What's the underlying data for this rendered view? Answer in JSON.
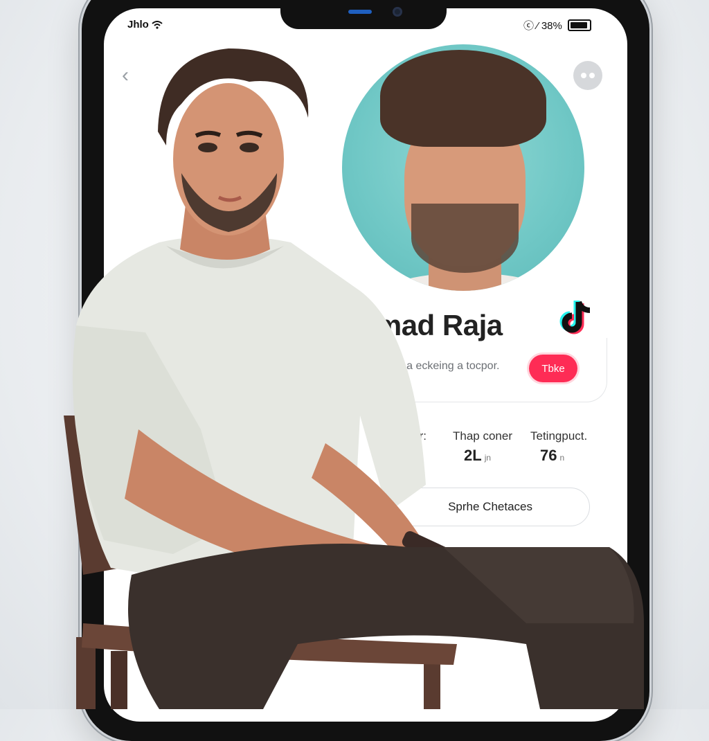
{
  "status_bar": {
    "carrier": "Jhlo",
    "right_text": "ⓒ ⁄ 38%"
  },
  "profile": {
    "name": "amad Raja",
    "bio": "duce a eckeing a tocpor.",
    "follow_label": "Tbke"
  },
  "stats": [
    {
      "label": "thar:",
      "value": ""
    },
    {
      "label": "Thap coner",
      "value": "2L",
      "unit": "jn"
    },
    {
      "label": "Tetingpuct.",
      "value": "76",
      "unit": "n"
    }
  ],
  "action": {
    "label": "Sprhe Chetaces"
  },
  "icons": {
    "back": "chevron-left-icon",
    "more": "more-icon",
    "wifi": "wifi-icon",
    "battery": "battery-icon",
    "brand": "tiktok-icon"
  },
  "colors": {
    "accent": "#fe2c55",
    "avatar_bg": "#6fc7c5",
    "tiktok_cyan": "#25f4ee",
    "tiktok_red": "#fe2c55"
  }
}
